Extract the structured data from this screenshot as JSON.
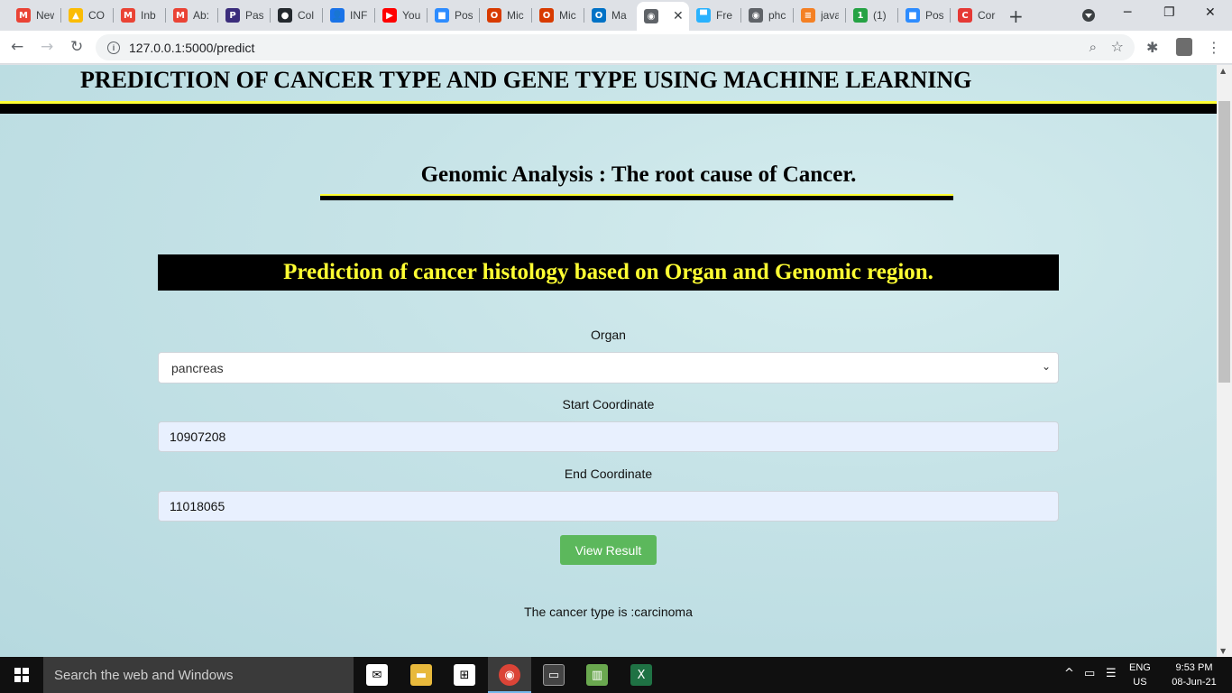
{
  "browser": {
    "tabs": [
      {
        "title": "New",
        "icon": "gmail-icon",
        "color": "#ea4335",
        "glyph": "M"
      },
      {
        "title": "CO",
        "icon": "google-drive-icon",
        "color": "#fbbc04",
        "glyph": "▲"
      },
      {
        "title": "Inb",
        "icon": "gmail-icon",
        "color": "#ea4335",
        "glyph": "M"
      },
      {
        "title": "Ab:",
        "icon": "gmail-icon",
        "color": "#ea4335",
        "glyph": "M"
      },
      {
        "title": "Pas",
        "icon": "pastebin-icon",
        "color": "#3b2d7c",
        "glyph": "P"
      },
      {
        "title": "Col",
        "icon": "github-icon",
        "color": "#24292e",
        "glyph": "●"
      },
      {
        "title": "INF",
        "icon": "contacts-icon",
        "color": "#1a73e8",
        "glyph": "👤"
      },
      {
        "title": "You",
        "icon": "youtube-icon",
        "color": "#ff0000",
        "glyph": "▶"
      },
      {
        "title": "Pos",
        "icon": "zoom-icon",
        "color": "#2d8cff",
        "glyph": "■"
      },
      {
        "title": "Mic",
        "icon": "office-icon",
        "color": "#d83b01",
        "glyph": "O"
      },
      {
        "title": "Mic",
        "icon": "office-icon",
        "color": "#d83b01",
        "glyph": "O"
      },
      {
        "title": "Ma",
        "icon": "outlook-icon",
        "color": "#0072c6",
        "glyph": "O"
      },
      {
        "title": "",
        "icon": "globe-icon",
        "color": "#5f6368",
        "glyph": "◉",
        "active": true
      },
      {
        "title": "Fre",
        "icon": "freelancer-icon",
        "color": "#29b2fe",
        "glyph": "▀"
      },
      {
        "title": "phc",
        "icon": "globe-icon",
        "color": "#5f6368",
        "glyph": "◉"
      },
      {
        "title": "java",
        "icon": "stackoverflow-icon",
        "color": "#f48024",
        "glyph": "≡"
      },
      {
        "title": "(1)",
        "icon": "notification-icon",
        "color": "#25a244",
        "glyph": "1"
      },
      {
        "title": "Pos",
        "icon": "zoom-icon",
        "color": "#2d8cff",
        "glyph": "■"
      },
      {
        "title": "Cor",
        "icon": "copyleaks-icon",
        "color": "#e53935",
        "glyph": "C"
      }
    ],
    "url": "127.0.0.1:5000/predict"
  },
  "page": {
    "main_title": "PREDICTION OF CANCER TYPE AND GENE TYPE USING MACHINE LEARNING",
    "subtitle": "Genomic Analysis : The root cause of Cancer.",
    "banner": "Prediction of cancer histology based on Organ and Genomic region.",
    "form": {
      "organ_label": "Organ",
      "organ_value": "pancreas",
      "start_label": "Start Coordinate",
      "start_value": "10907208",
      "end_label": "End Coordinate",
      "end_value": "11018065",
      "submit_label": "View Result"
    },
    "result": "The cancer type is :carcinoma"
  },
  "taskbar": {
    "search_placeholder": "Search the web and Windows",
    "lang_top": "ENG",
    "lang_bottom": "US",
    "time": "9:53 PM",
    "date": "08-Jun-21"
  }
}
